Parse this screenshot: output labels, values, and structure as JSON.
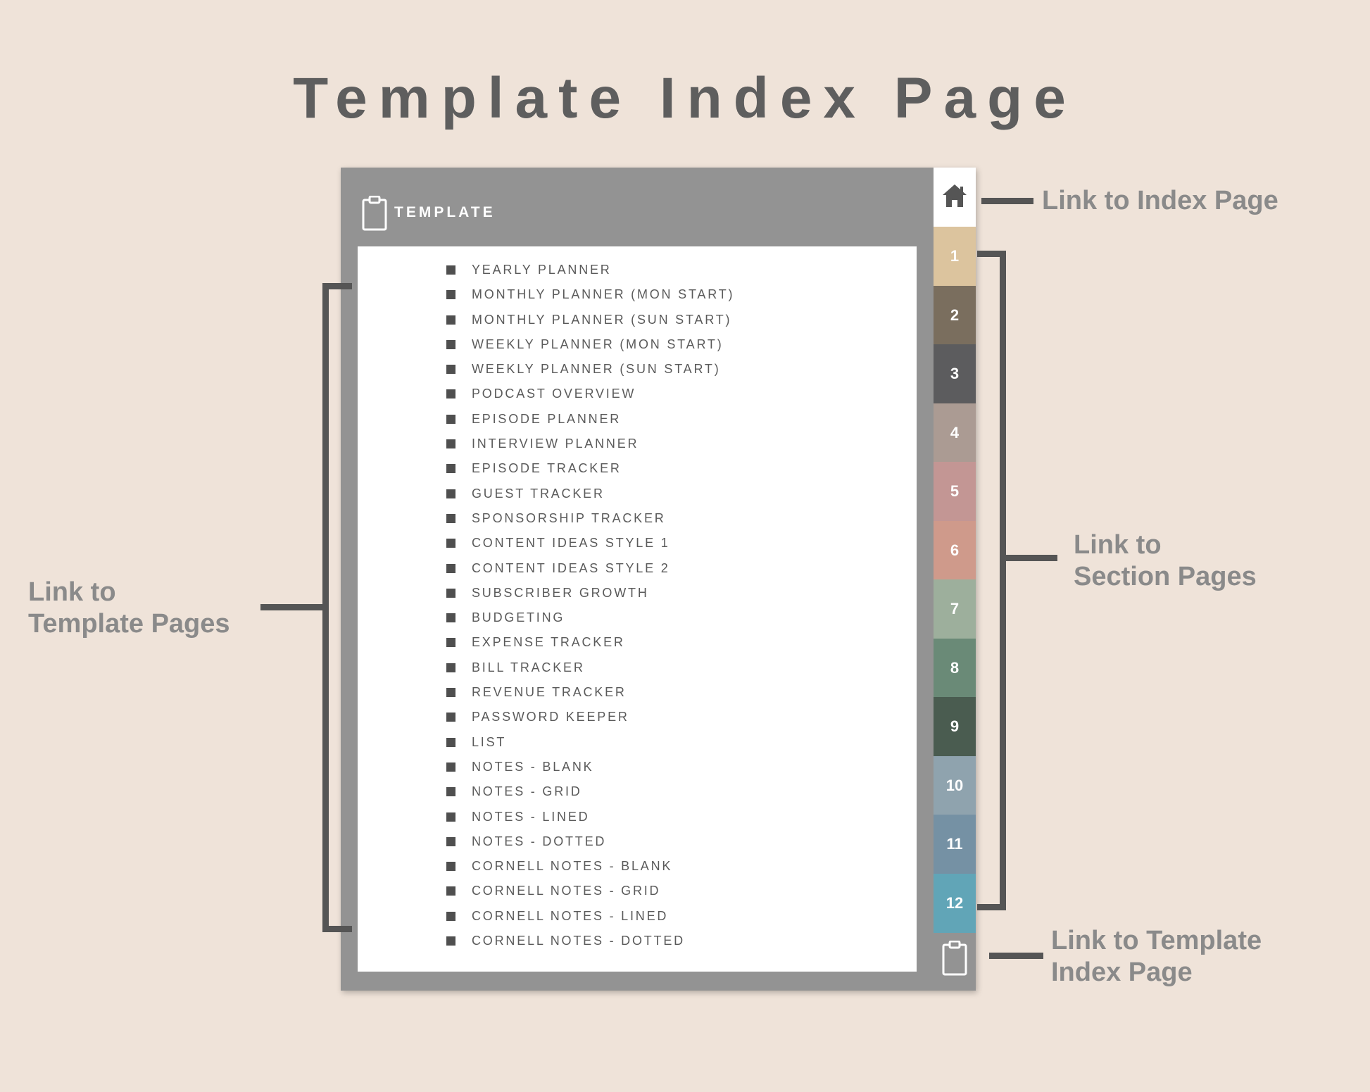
{
  "title": "Template Index Page",
  "planner": {
    "header_label": "TEMPLATE",
    "templates": [
      "YEARLY PLANNER",
      "MONTHLY PLANNER (MON START)",
      "MONTHLY PLANNER (SUN START)",
      "WEEKLY PLANNER (MON START)",
      "WEEKLY PLANNER (SUN START)",
      "PODCAST OVERVIEW",
      "EPISODE PLANNER",
      "INTERVIEW PLANNER",
      "EPISODE TRACKER",
      "GUEST TRACKER",
      "SPONSORSHIP TRACKER",
      "CONTENT IDEAS STYLE 1",
      "CONTENT IDEAS STYLE 2",
      "SUBSCRIBER GROWTH",
      "BUDGETING",
      "EXPENSE TRACKER",
      "BILL TRACKER",
      "REVENUE TRACKER",
      "PASSWORD KEEPER",
      "LIST",
      "NOTES - BLANK",
      "NOTES - GRID",
      "NOTES - LINED",
      "NOTES - DOTTED",
      "CORNELL NOTES - BLANK",
      "CORNELL NOTES - GRID",
      "CORNELL NOTES - LINED",
      "CORNELL NOTES - DOTTED"
    ],
    "section_tabs": [
      {
        "label": "1",
        "color": "#dcc49e"
      },
      {
        "label": "2",
        "color": "#7a6e5e"
      },
      {
        "label": "3",
        "color": "#5c5c5e"
      },
      {
        "label": "4",
        "color": "#ab9b93"
      },
      {
        "label": "5",
        "color": "#c39694"
      },
      {
        "label": "6",
        "color": "#cf9a8b"
      },
      {
        "label": "7",
        "color": "#9daf9c"
      },
      {
        "label": "8",
        "color": "#6a8a77"
      },
      {
        "label": "9",
        "color": "#4a5c50"
      },
      {
        "label": "10",
        "color": "#8fa3ae"
      },
      {
        "label": "11",
        "color": "#7591a4"
      },
      {
        "label": "12",
        "color": "#61a5b7"
      }
    ],
    "icons": {
      "home": "home-icon",
      "header": "clipboard-icon",
      "bottom": "clipboard-icon"
    }
  },
  "annotations": {
    "index_page": "Link to Index Page",
    "section_line1": "Link to",
    "section_line2": "Section Pages",
    "template_line1": "Link to",
    "template_line2": "Template Pages",
    "template_index_line1": "Link to Template",
    "template_index_line2": "Index Page"
  },
  "colors": {
    "background": "#efe3d9",
    "frame": "#939393",
    "annotation_text": "#8a8a8a",
    "annotation_line": "#555555",
    "title_text": "#5e5e5e"
  }
}
